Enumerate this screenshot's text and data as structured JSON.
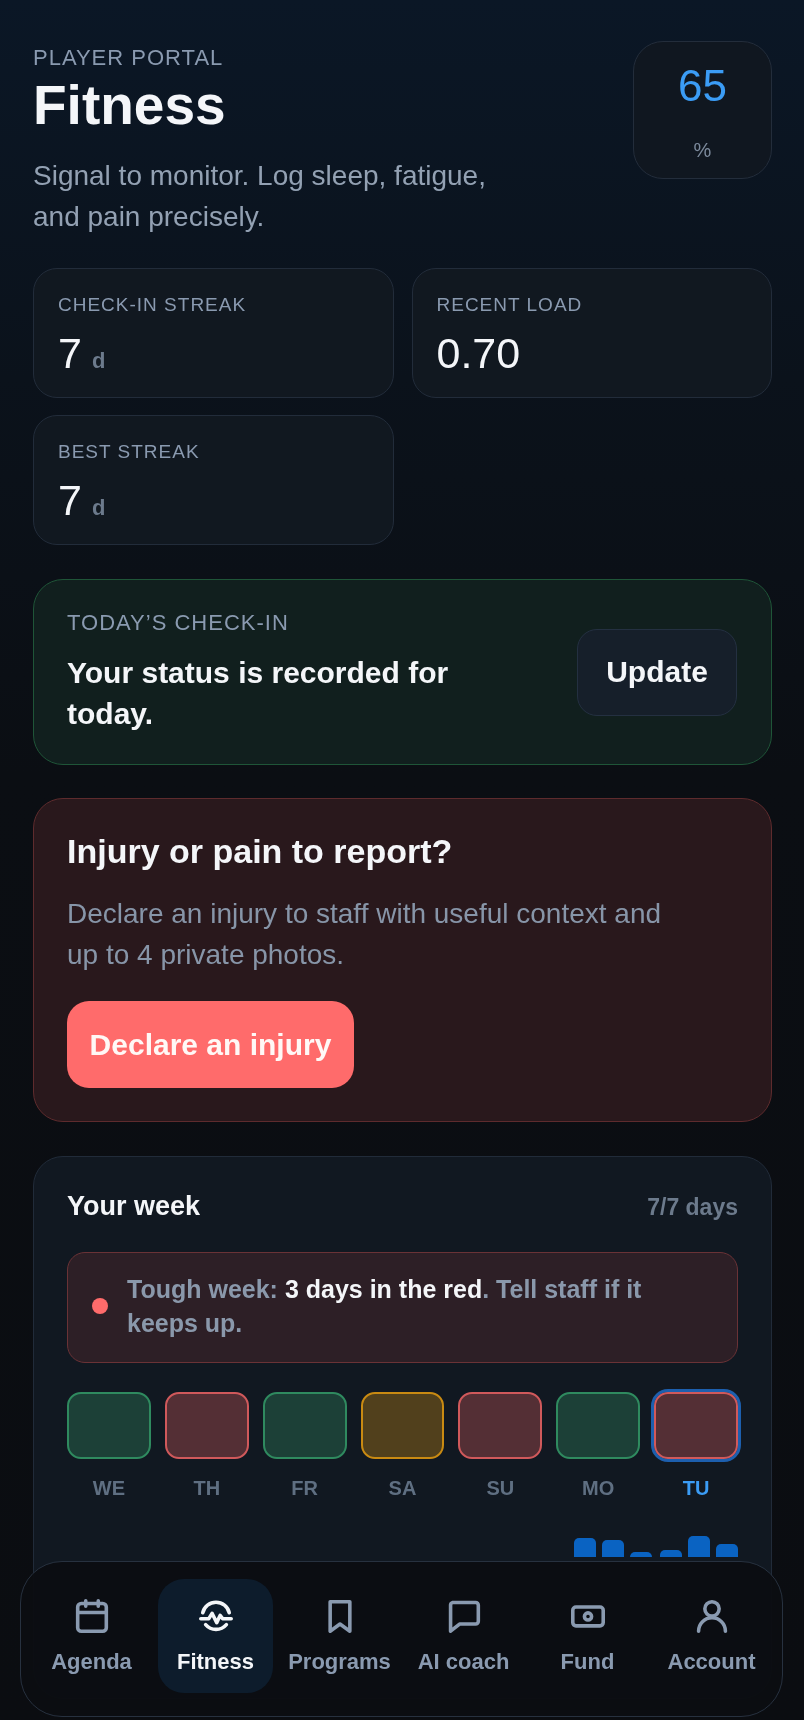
{
  "header": {
    "eyebrow": "PLAYER PORTAL",
    "title": "Fitness",
    "subtitle": "Signal to monitor. Log sleep, fatigue, and pain precisely.",
    "score": {
      "value": "65",
      "unit": "%"
    }
  },
  "stats": [
    {
      "label": "CHECK-IN STREAK",
      "value": "7",
      "unit": "d"
    },
    {
      "label": "RECENT LOAD",
      "value": "0.70"
    },
    {
      "label": "BEST STREAK",
      "value": "7",
      "unit": "d"
    }
  ],
  "checkin": {
    "eyebrow": "TODAY’S CHECK-IN",
    "message": "Your status is recorded for today.",
    "button": "Update"
  },
  "injury": {
    "title": "Injury or pain to report?",
    "description": "Declare an injury to staff with useful context and up to 4 private photos.",
    "button": "Declare an injury"
  },
  "week": {
    "title": "Your week",
    "count": "7/7 days",
    "alert": {
      "text": "Tough week: **3 days in the red**. Tell staff if it keeps up."
    },
    "days": [
      {
        "label": "WE",
        "color": "#2f8a5f",
        "selected": false
      },
      {
        "label": "TH",
        "color": "#d0595b",
        "selected": false
      },
      {
        "label": "FR",
        "color": "#2f8a5f",
        "selected": false
      },
      {
        "label": "SA",
        "color": "#c98a12",
        "selected": false
      },
      {
        "label": "SU",
        "color": "#d0595b",
        "selected": false
      },
      {
        "label": "MO",
        "color": "#2f8a5f",
        "selected": false
      },
      {
        "label": "TU",
        "color": "#d0595b",
        "selected": true
      }
    ]
  },
  "nav": [
    {
      "label": "Agenda",
      "selected": false
    },
    {
      "label": "Fitness",
      "selected": true
    },
    {
      "label": "Programs",
      "selected": false
    },
    {
      "label": "AI coach",
      "selected": false
    },
    {
      "label": "Fund",
      "selected": false
    },
    {
      "label": "Account",
      "selected": false
    }
  ]
}
